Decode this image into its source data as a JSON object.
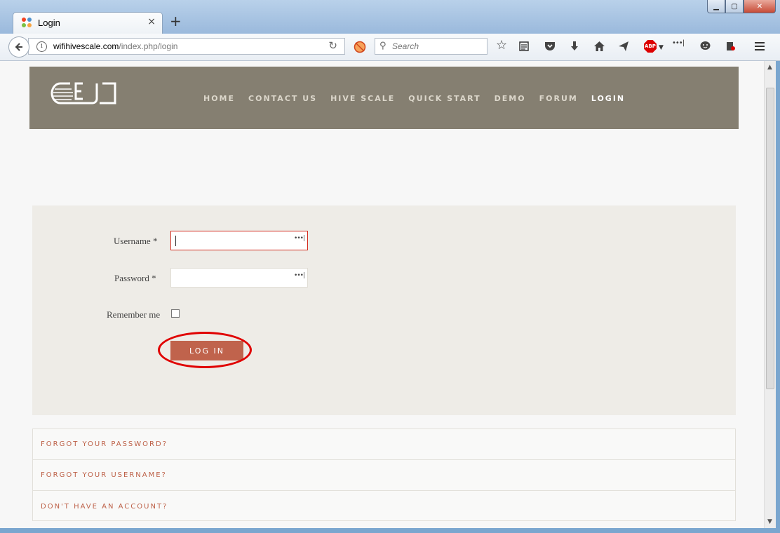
{
  "browser": {
    "tab_title": "Login",
    "new_tab_symbol": "+",
    "close_tab_symbol": "×",
    "url_host": "wifihivescale.com",
    "url_path": "/index.php/login",
    "search_placeholder": "Search",
    "window_buttons": {
      "minimize": "▁",
      "maximize": "▢",
      "close": "✕"
    }
  },
  "site": {
    "nav": [
      {
        "label": "HOME"
      },
      {
        "label": "CONTACT US"
      },
      {
        "label": "HIVE SCALE"
      },
      {
        "label": "QUICK START"
      },
      {
        "label": "DEMO"
      },
      {
        "label": "FORUM"
      },
      {
        "label": "LOGIN",
        "active": true
      }
    ]
  },
  "login_form": {
    "username_label": "Username *",
    "username_value": "",
    "password_label": "Password *",
    "password_value": "",
    "remember_label": "Remember me",
    "remember_checked": false,
    "submit_label": "LOG IN",
    "highlight_color": "#e00000"
  },
  "links": [
    {
      "label": "FORGOT YOUR PASSWORD?"
    },
    {
      "label": "FORGOT YOUR USERNAME?"
    },
    {
      "label": "DON'T HAVE AN ACCOUNT?"
    }
  ],
  "colors": {
    "header_bg": "#857f71",
    "button_bg": "#c0634c",
    "link_color": "#bd6148"
  }
}
